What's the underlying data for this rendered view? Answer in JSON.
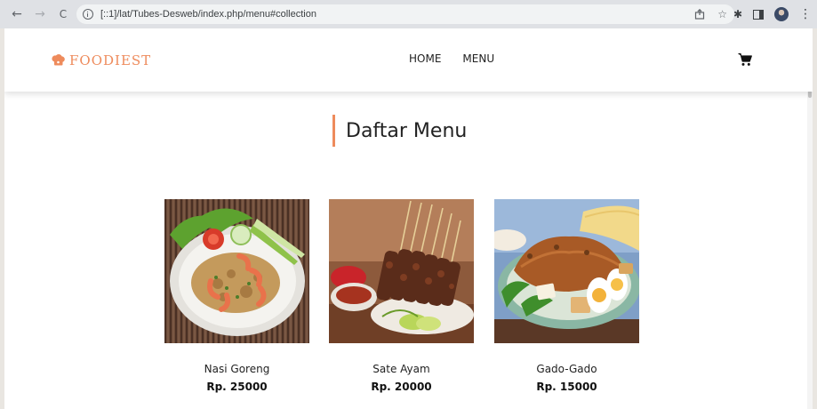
{
  "browser": {
    "url": "[::1]/lat/Tubes-Desweb/index.php/menu#collection",
    "back_glyph": "←",
    "forward_glyph": "→",
    "reload_glyph": "C",
    "share_icon": "share-icon",
    "star_glyph": "☆",
    "extensions_glyph": "✱",
    "menu_glyph": "⋮"
  },
  "site": {
    "logo_text": "FOODIEST",
    "nav": [
      {
        "label": "HOME"
      },
      {
        "label": "MENU"
      }
    ],
    "accent_color": "#ee8b5c"
  },
  "page": {
    "title": "Daftar Menu"
  },
  "menu_items": [
    {
      "name": "Nasi Goreng",
      "price": "Rp. 25000",
      "image": "fried-rice-photo"
    },
    {
      "name": "Sate Ayam",
      "price": "Rp. 20000",
      "image": "chicken-satay-photo"
    },
    {
      "name": "Gado-Gado",
      "price": "Rp. 15000",
      "image": "gado-gado-photo"
    }
  ]
}
